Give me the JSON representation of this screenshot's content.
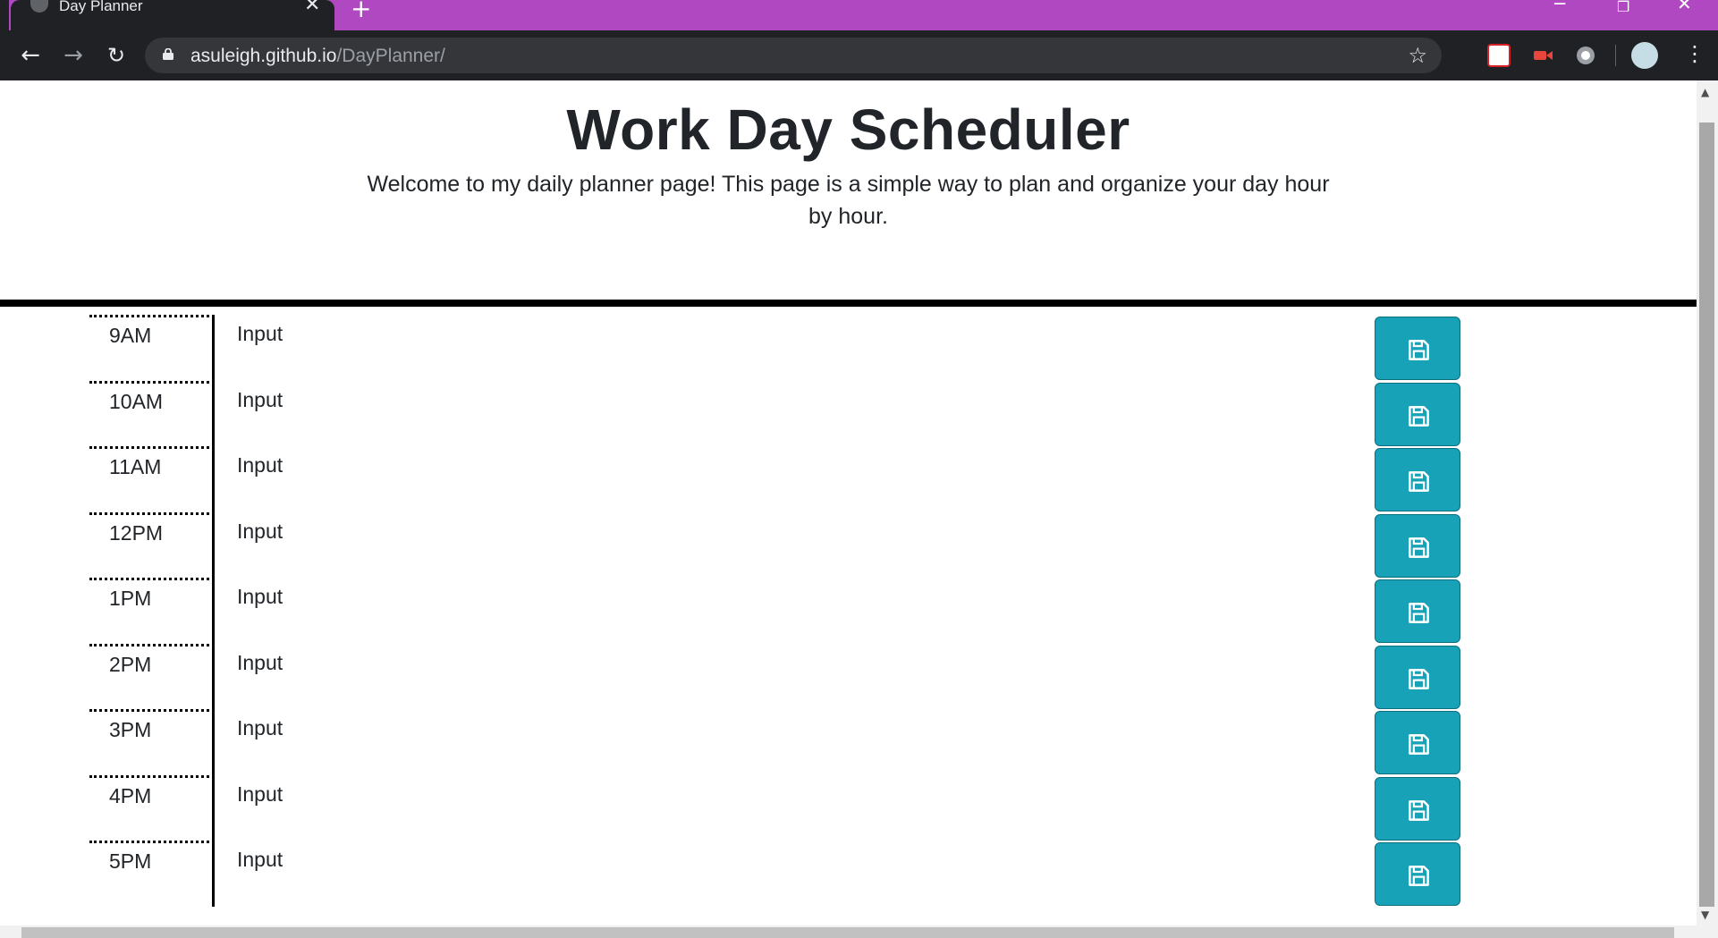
{
  "browser": {
    "tab_title": "Day Planner",
    "tab_close": "✕",
    "new_tab": "+",
    "url_host": "asuleigh.github.io",
    "url_path": "/DayPlanner/"
  },
  "header": {
    "title": "Work Day Scheduler",
    "lead": "Welcome to my daily planner page! This page is a simple way to plan and organize your day hour by hour."
  },
  "planner": {
    "rows": [
      {
        "hour": "9AM",
        "task": "Input"
      },
      {
        "hour": "10AM",
        "task": "Input"
      },
      {
        "hour": "11AM",
        "task": "Input"
      },
      {
        "hour": "12PM",
        "task": "Input"
      },
      {
        "hour": "1PM",
        "task": "Input"
      },
      {
        "hour": "2PM",
        "task": "Input"
      },
      {
        "hour": "3PM",
        "task": "Input"
      },
      {
        "hour": "4PM",
        "task": "Input"
      },
      {
        "hour": "5PM",
        "task": "Input"
      }
    ],
    "save_icon": "floppy-disk-icon"
  },
  "colors": {
    "tab_strip": "#b048c2",
    "toolbar": "#202124",
    "save_button": "#17a2b8"
  }
}
